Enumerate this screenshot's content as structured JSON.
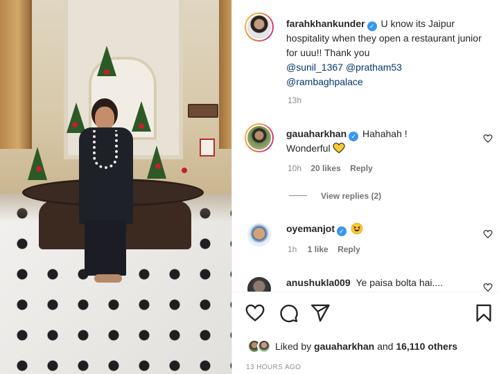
{
  "post": {
    "author": "farahkhankunder",
    "caption_text": "U know its Jaipur hospitality when they open a restaurant junior for uuu!! Thank you",
    "mentions": [
      "@sunil_1367",
      "@pratham53",
      "@rambaghpalace"
    ],
    "age": "13h"
  },
  "comments": [
    {
      "username": "gauaharkhan",
      "text": "Hahahah !",
      "text_line2": "Wonderful",
      "emoji": "yellow-heart-emoji",
      "age": "10h",
      "likes": "20 likes",
      "reply_label": "Reply"
    },
    {
      "username": "oyemanjot",
      "text": "",
      "emoji": "grinning-squint-emoji",
      "age": "1h",
      "likes": "1 like",
      "reply_label": "Reply"
    },
    {
      "username": "anushukla009",
      "text": "Ye paisa bolta hai...."
    }
  ],
  "view_replies": "View replies (2)",
  "footer": {
    "liked_by_prefix": "Liked by",
    "liked_by_user": "gauaharkhan",
    "liked_by_and": "and",
    "liked_by_count": "16,110 others",
    "timestamp": "13 HOURS AGO"
  },
  "colors": {
    "verified": "#3897f0",
    "mention": "#00376b",
    "meta": "#8e8e8e"
  }
}
